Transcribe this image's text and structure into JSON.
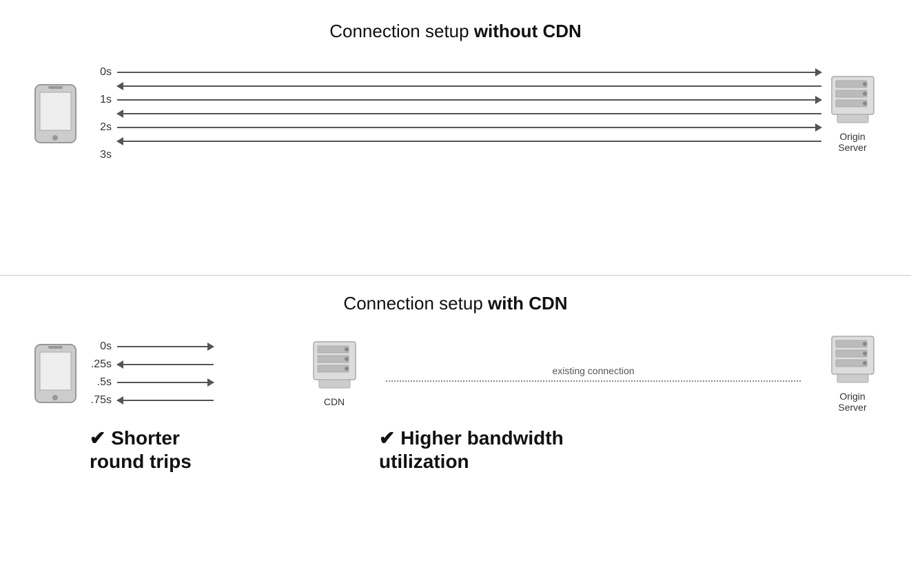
{
  "top_section": {
    "title_normal": "Connection setup ",
    "title_bold": "without CDN",
    "time_labels": [
      "0s",
      "1s",
      "2s",
      "3s"
    ],
    "server_label": "Origin\nServer",
    "arrows": [
      {
        "direction": "right"
      },
      {
        "direction": "left"
      },
      {
        "direction": "right"
      },
      {
        "direction": "left"
      },
      {
        "direction": "right"
      },
      {
        "direction": "left"
      }
    ]
  },
  "bottom_section": {
    "title_normal": "Connection setup ",
    "title_bold": "with CDN",
    "cdn_time_labels": [
      "0s",
      ".25s",
      ".5s",
      ".75s"
    ],
    "cdn_label": "CDN",
    "existing_connection_label": "existing connection",
    "server_label": "Origin\nServer",
    "benefit_left": "✔ Shorter\nround trips",
    "benefit_right": "✔ Higher bandwidth\nutilization"
  }
}
